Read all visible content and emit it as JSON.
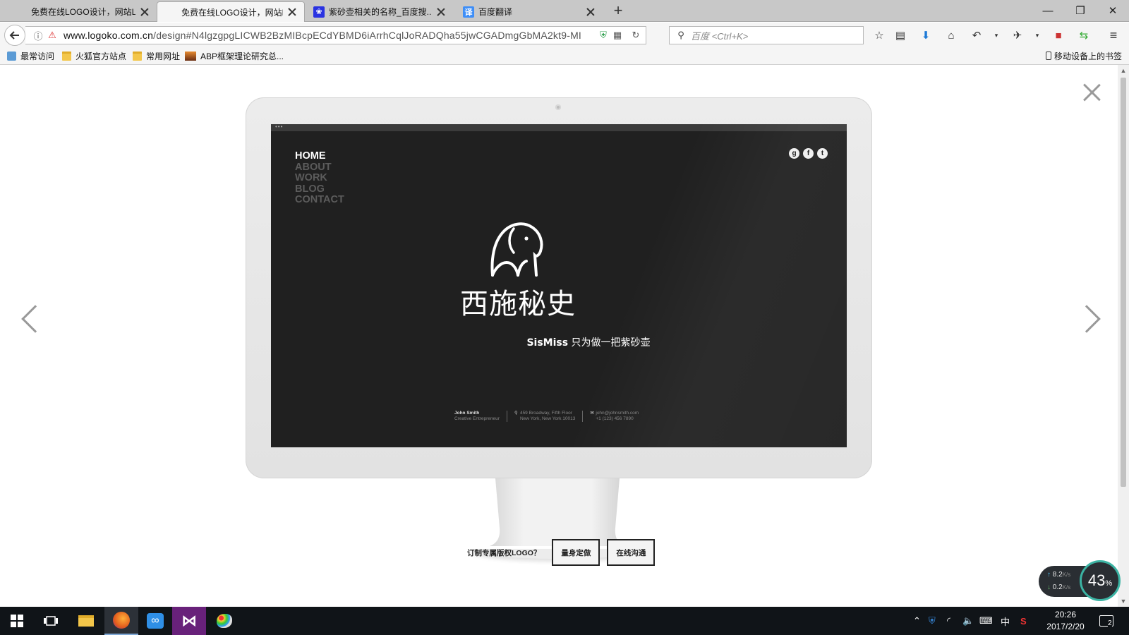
{
  "browser": {
    "tabs": [
      {
        "title": "免费在线LOGO设计，网站LO...",
        "active": false
      },
      {
        "title": "免费在线LOGO设计，网站LO...",
        "active": true
      },
      {
        "title": "紫砂壶相关的名称_百度搜...",
        "active": false
      },
      {
        "title": "百度翻译",
        "active": false
      }
    ],
    "new_tab_label": "+",
    "window_controls": {
      "minimize": "—",
      "maximize": "❐",
      "close": "✕"
    },
    "url_host": "www.logoko.com.cn",
    "url_path": "/design#N4lgzgpgLICWB2BzMIBcpECdYBMD6iArrhCqlJoRADQha55jwCGADmgGbMA2kt9-MI",
    "search_placeholder": "百度 <Ctrl+K>",
    "bookmarks": [
      "最常访问",
      "火狐官方站点",
      "常用网址",
      "ABP框架理论研究总..."
    ],
    "mobile_bookmarks": "移动设备上的书签"
  },
  "overlay": {
    "screen": {
      "nav": [
        "HOME",
        "ABOUT",
        "WORK",
        "BLOG",
        "CONTACT"
      ],
      "brand_name": "西施秘史",
      "slogan_en": "SisMiss",
      "slogan_cn": " 只为做一把紫砂壶",
      "footer": {
        "name": "John Smith",
        "role": "Creative Entrepreneur",
        "address_line1": "459 Broadway, Fifth Floor",
        "address_line2": "New York, New York 10013",
        "email": "john@johnsmith.com",
        "phone": "+1 (123) 456 7890"
      }
    },
    "cta_text": "订制专属版权LOGO？",
    "cta_button_custom": "量身定做",
    "cta_button_chat": "在线沟通"
  },
  "speed_widget": {
    "upload": "8.2",
    "download": "0.2",
    "unit": "K/s",
    "percent": "43",
    "percent_sign": "%"
  },
  "taskbar": {
    "time": "20:26",
    "date": "2017/2/20",
    "ime": "中",
    "notification_count": "2"
  },
  "colors": {
    "screen_bg": "#202020",
    "accent_ring": "#3bb3a3",
    "taskbar_bg": "#101418"
  }
}
